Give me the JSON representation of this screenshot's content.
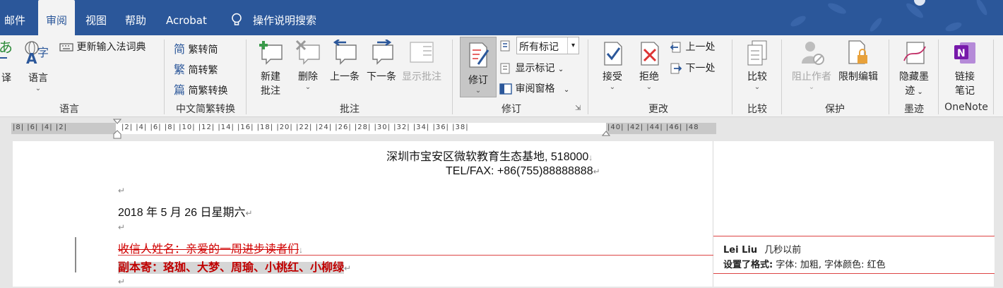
{
  "tabs": [
    {
      "label": "邮件",
      "active": false
    },
    {
      "label": "审阅",
      "active": true
    },
    {
      "label": "视图",
      "active": false
    },
    {
      "label": "帮助",
      "active": false
    },
    {
      "label": "Acrobat",
      "active": false
    }
  ],
  "tell_me": "操作说明搜索",
  "ribbon": {
    "language": {
      "translate": "译",
      "language": "语言",
      "update_ime": "更新输入法词典",
      "group": "语言"
    },
    "chinese_conversion": {
      "to_simplified": "繁转简",
      "to_traditional": "简转繁",
      "convert": "简繁转换",
      "group": "中文简繁转换"
    },
    "comments": {
      "new_line1": "新建",
      "new_line2": "批注",
      "delete": "删除",
      "previous": "上一条",
      "next": "下一条",
      "show": "显示批注",
      "group": "批注"
    },
    "tracking": {
      "track_changes": "修订",
      "markup_select": "所有标记",
      "show_markup": "显示标记",
      "reviewing_pane": "审阅窗格",
      "group": "修订"
    },
    "changes": {
      "accept": "接受",
      "reject": "拒绝",
      "previous": "上一处",
      "next": "下一处",
      "group": "更改"
    },
    "compare": {
      "compare": "比较",
      "group": "比较"
    },
    "protect": {
      "block_authors": "阻止作者",
      "restrict": "限制编辑",
      "group": "保护"
    },
    "ink": {
      "hide_ink_line1": "隐藏墨",
      "hide_ink_line2": "迹",
      "group": "墨迹"
    },
    "onenote": {
      "linked_line1": "链接",
      "linked_line2": "笔记",
      "group": "OneNote"
    }
  },
  "ruler": {
    "left_numbers": "|8|  |6|  |4|  |2|",
    "right_numbers": "|2|  |4|  |6|  |8|  |10|  |12|  |14|  |16|  |18|  |20|  |22|  |24|  |26|  |28|  |30|  |32|  |34|  |36|  |38|",
    "margin_numbers": "|40|  |42|  |44|  |46|  |48"
  },
  "document": {
    "address": "深圳市宝安区微软教育生态基地, 518000",
    "telfax": "TEL/FAX: +86(755)88888888",
    "date": "2018 年 5 月 26 日星期六",
    "deleted_text": "收信人姓名：亲爱的一周进步读者们",
    "formatted_text": "副本寄：珞珈、大梦、周瑜、小桃红、小柳绿",
    "para_mark": "↵",
    "line_mark": "↓"
  },
  "comment": {
    "author": "Lei Liu",
    "time": "几秒以前",
    "action_label": "设置了格式:",
    "action_detail": "字体: 加粗, 字体颜色: 红色"
  },
  "colors": {
    "tab_bar": "#2b579a",
    "ribbon_bg": "#f3f3f3",
    "deleted": "#d00000",
    "formatted": "#c00000",
    "onenote": "#7719aa"
  }
}
